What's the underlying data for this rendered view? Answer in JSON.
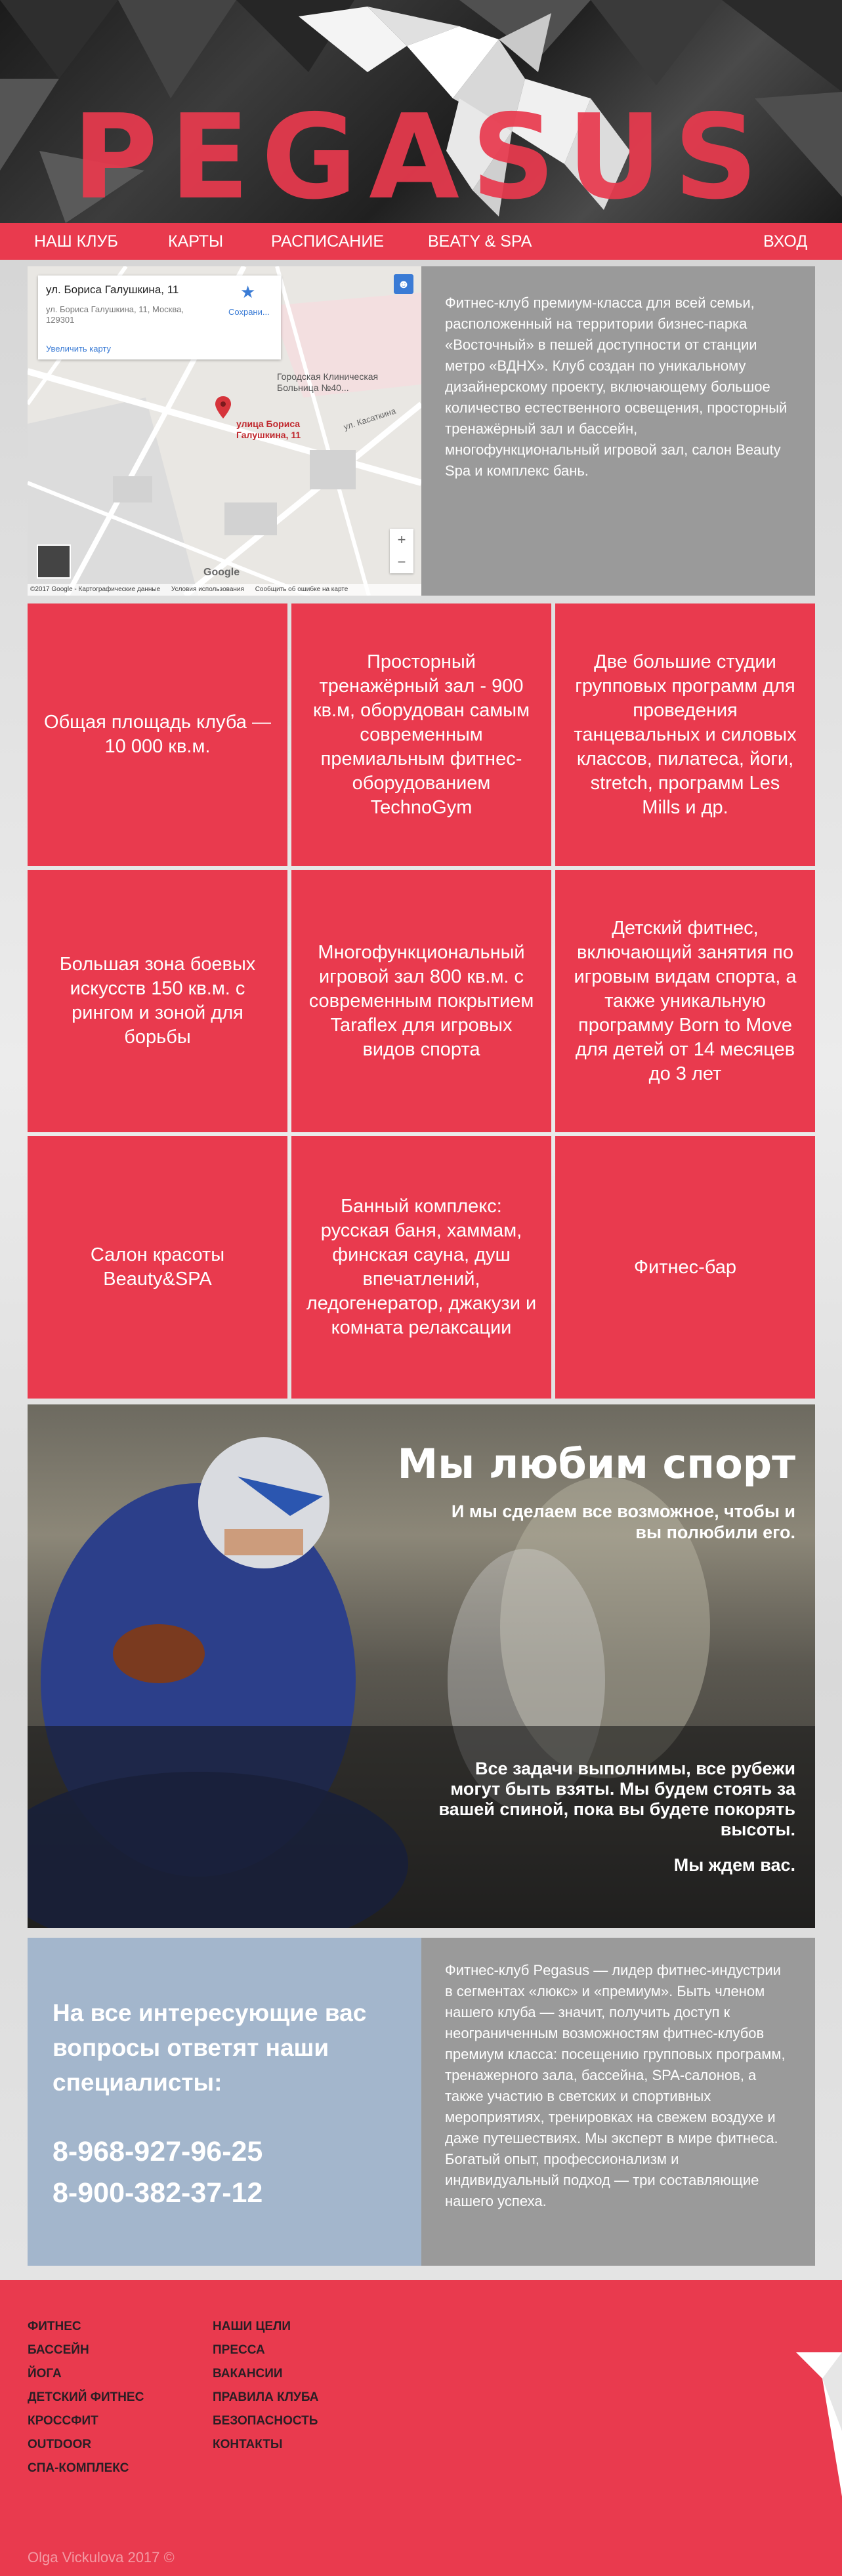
{
  "brand": {
    "logo_text": "PEGASUS",
    "accent": "#e93a4e"
  },
  "nav": {
    "items": [
      {
        "label": "НАШ КЛУБ"
      },
      {
        "label": "КАРТЫ"
      },
      {
        "label": "РАСПИСАНИЕ"
      },
      {
        "label": "BEATY & SPA"
      }
    ],
    "login": "ВХОД"
  },
  "map": {
    "card_title": "ул. Бориса Галушкина, 11",
    "card_address": "ул. Бориса Галушкина, 11, Москва, 129301",
    "save_label": "Сохрани...",
    "enlarge_link": "Увеличить карту",
    "hospital": "Городская Клиническая Больница №40...",
    "street": "ул. Касаткина",
    "pin_label": "улица Бориса Галушкина, 11",
    "google": "Google",
    "footer_data": "©2017 Google - Картографические данные",
    "footer_terms": "Условия использования",
    "footer_report": "Сообщить об ошибке на карте",
    "zoom_in": "+",
    "zoom_out": "−"
  },
  "about": "Фитнес-клуб премиум-класса для всей семьи, расположенный на территории бизнес-парка «Восточный» в пешей доступности от станции метро «ВДНХ». Клуб создан по уникальному дизайнерскому проекту, включающему большое количество естественного освещения, просторный тренажёрный зал и бассейн, многофункциональный игровой зал, салон Beauty Spa и комплекс бань.",
  "features": [
    "Общая площадь клуба — 10 000 кв.м.",
    "Просторный тренажёрный зал - 900 кв.м, оборудован самым современным премиальным фитнес-оборудованием TechnoGym",
    "Две большие студии групповых программ для проведения танцевальных и силовых классов, пилатеса, йоги, stretch, программ Les Mills и др.",
    "Большая зона боевых искусств 150 кв.м. с рингом и зоной для борьбы",
    "Многофункциональный игровой зал 800 кв.м. с современным покрытием Taraflex для игровых видов спорта",
    "Детский фитнес, включающий занятия по игровым видам спорта, а также уникальную программу Born to Move для детей от 14 месяцев до 3 лет",
    "Салон красоты Beauty&SPA",
    "Банный комплекс: русская баня, хаммам, финская сауна, душ впечатлений, ледогенератор, джакузи и комната релаксации",
    "Фитнес-бар"
  ],
  "sport": {
    "title": "Мы любим спорт",
    "subtitle": "И мы сделаем все возможное, чтобы и вы полюбили его.",
    "paragraph": "Все задачи выполнимы, все рубежи могут быть взяты. Мы будем стоять за вашей спиной, пока вы будете покорять высоты.",
    "waiting": "Мы ждем вас."
  },
  "contact": {
    "heading": "На все интересующие вас вопросы ответят наши специалисты:",
    "phone1": "8-968-927-96-25",
    "phone2": "8-900-382-37-12"
  },
  "leader": "Фитнес-клуб Pegasus — лидер фитнес-индустрии в сегментах «люкс» и «премиум». Быть членом нашего клуба — значит, получить доступ к неограниченным возможностям фитнес-клубов премиум класса: посещению групповых программ, тренажерного зала, бассейна, SPA-салонов, а также участию в светских и спортивных мероприятиях, тренировках на свежем воздухе и даже путешествиях. Мы эксперт в мире фитнеса. Богатый опыт, профессионализм и индивидуальный подход — три составляющие нашего успеха.",
  "footer": {
    "col1": [
      "ФИТНЕС",
      "БАССЕЙН",
      "ЙОГА",
      "ДЕТСКИЙ ФИТНЕС",
      "КРОССФИТ",
      "OUTDOOR",
      "СПА-КОМПЛЕКС"
    ],
    "col2": [
      "НАШИ ЦЕЛИ",
      "ПРЕССА",
      "ВАКАНСИИ",
      "ПРАВИЛА КЛУБА",
      "БЕЗОПАСНОСТЬ",
      "КОНТАКТЫ"
    ],
    "copyright": "Olga Vickulova 2017 ©"
  }
}
